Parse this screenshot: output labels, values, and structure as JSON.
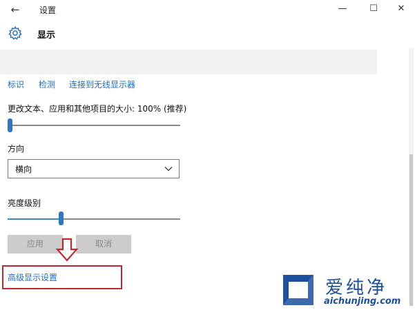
{
  "window": {
    "title": "设置",
    "back_icon": "←",
    "minimize_icon": "—",
    "maximize_icon": "☐",
    "close_icon": "✕"
  },
  "header": {
    "title": "显示"
  },
  "links": {
    "identify": "标识",
    "detect": "检测",
    "connect_wireless": "连接到无线显示器"
  },
  "scale": {
    "label": "更改文本、应用和其他项目的大小: 100% (推荐)",
    "level": 0.0
  },
  "orientation": {
    "label": "方向",
    "value": "横向"
  },
  "brightness": {
    "label": "亮度级别",
    "level": 0.32
  },
  "buttons": {
    "apply": "应用",
    "cancel": "取消"
  },
  "advanced_link": "高级显示设置",
  "watermark": {
    "text": "爱纯净",
    "url": "aichunjing.com"
  },
  "colors": {
    "accent": "#2c78c4",
    "link": "#1e6ec4",
    "annotation": "#c0282d",
    "watermark": "#1c4f9e"
  }
}
